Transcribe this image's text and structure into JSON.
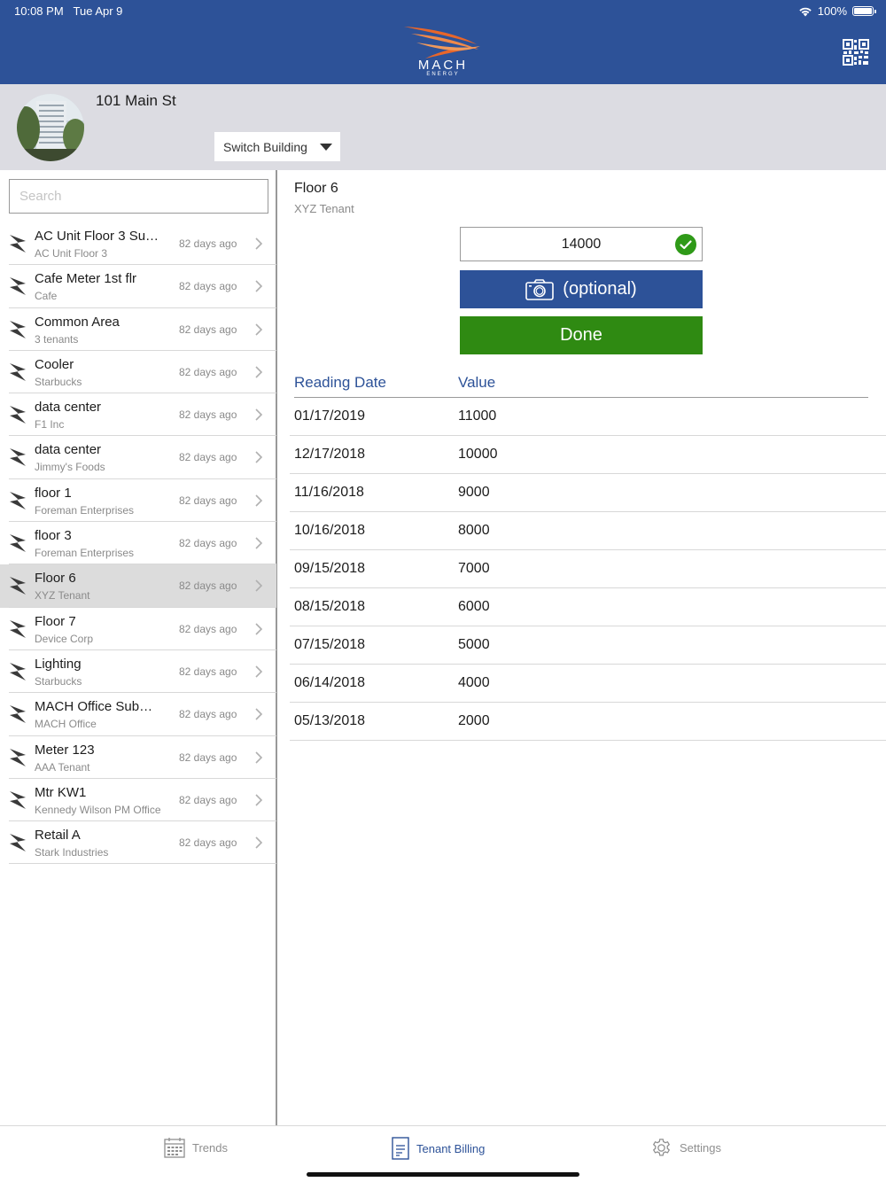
{
  "status": {
    "time": "10:08 PM",
    "date": "Tue Apr 9",
    "battery": "100%"
  },
  "brand": {
    "name": "MACH",
    "tagline": "ENERGY",
    "primary_color": "#2d5298",
    "accent_color": "#e8662a"
  },
  "building": {
    "name": "101 Main St",
    "switch_label": "Switch Building"
  },
  "search": {
    "placeholder": "Search",
    "value": ""
  },
  "meters": [
    {
      "title": "AC Unit Floor 3 Su…",
      "subtitle": "AC Unit Floor 3",
      "age": "82 days ago"
    },
    {
      "title": "Cafe Meter 1st flr",
      "subtitle": "Cafe",
      "age": "82 days ago"
    },
    {
      "title": "Common Area",
      "subtitle": "3 tenants",
      "age": "82 days ago"
    },
    {
      "title": "Cooler",
      "subtitle": "Starbucks",
      "age": "82 days ago"
    },
    {
      "title": "data center",
      "subtitle": "F1 Inc",
      "age": "82 days ago"
    },
    {
      "title": "data center",
      "subtitle": "Jimmy's Foods",
      "age": "82 days ago"
    },
    {
      "title": "floor 1",
      "subtitle": "Foreman Enterprises",
      "age": "82 days ago"
    },
    {
      "title": "floor 3",
      "subtitle": "Foreman Enterprises",
      "age": "82 days ago"
    },
    {
      "title": "Floor 6",
      "subtitle": "XYZ Tenant",
      "age": "82 days ago",
      "selected": true
    },
    {
      "title": "Floor 7",
      "subtitle": "Device Corp",
      "age": "82 days ago"
    },
    {
      "title": "Lighting",
      "subtitle": "Starbucks",
      "age": "82 days ago"
    },
    {
      "title": "MACH Office Sub…",
      "subtitle": "MACH Office",
      "age": "82 days ago"
    },
    {
      "title": "Meter 123",
      "subtitle": "AAA Tenant",
      "age": "82 days ago"
    },
    {
      "title": "Mtr KW1",
      "subtitle": "Kennedy Wilson PM Office",
      "age": "82 days ago"
    },
    {
      "title": "Retail A",
      "subtitle": "Stark Industries",
      "age": "82 days ago"
    }
  ],
  "detail": {
    "title": "Floor 6",
    "subtitle": "XYZ Tenant",
    "reading_value": "14000",
    "photo_label": "(optional)",
    "done_label": "Done",
    "columns": [
      "Reading Date",
      "Value"
    ],
    "readings": [
      {
        "date": "01/17/2019",
        "value": "11000"
      },
      {
        "date": "12/17/2018",
        "value": "10000"
      },
      {
        "date": "11/16/2018",
        "value": "9000"
      },
      {
        "date": "10/16/2018",
        "value": "8000"
      },
      {
        "date": "09/15/2018",
        "value": "7000"
      },
      {
        "date": "08/15/2018",
        "value": "6000"
      },
      {
        "date": "07/15/2018",
        "value": "5000"
      },
      {
        "date": "06/14/2018",
        "value": "4000"
      },
      {
        "date": "05/13/2018",
        "value": "2000"
      }
    ]
  },
  "tabs": [
    {
      "label": "Trends",
      "icon": "calendar-icon",
      "active": false
    },
    {
      "label": "Tenant Billing",
      "icon": "document-icon",
      "active": true
    },
    {
      "label": "Settings",
      "icon": "gear-icon",
      "active": false
    }
  ]
}
